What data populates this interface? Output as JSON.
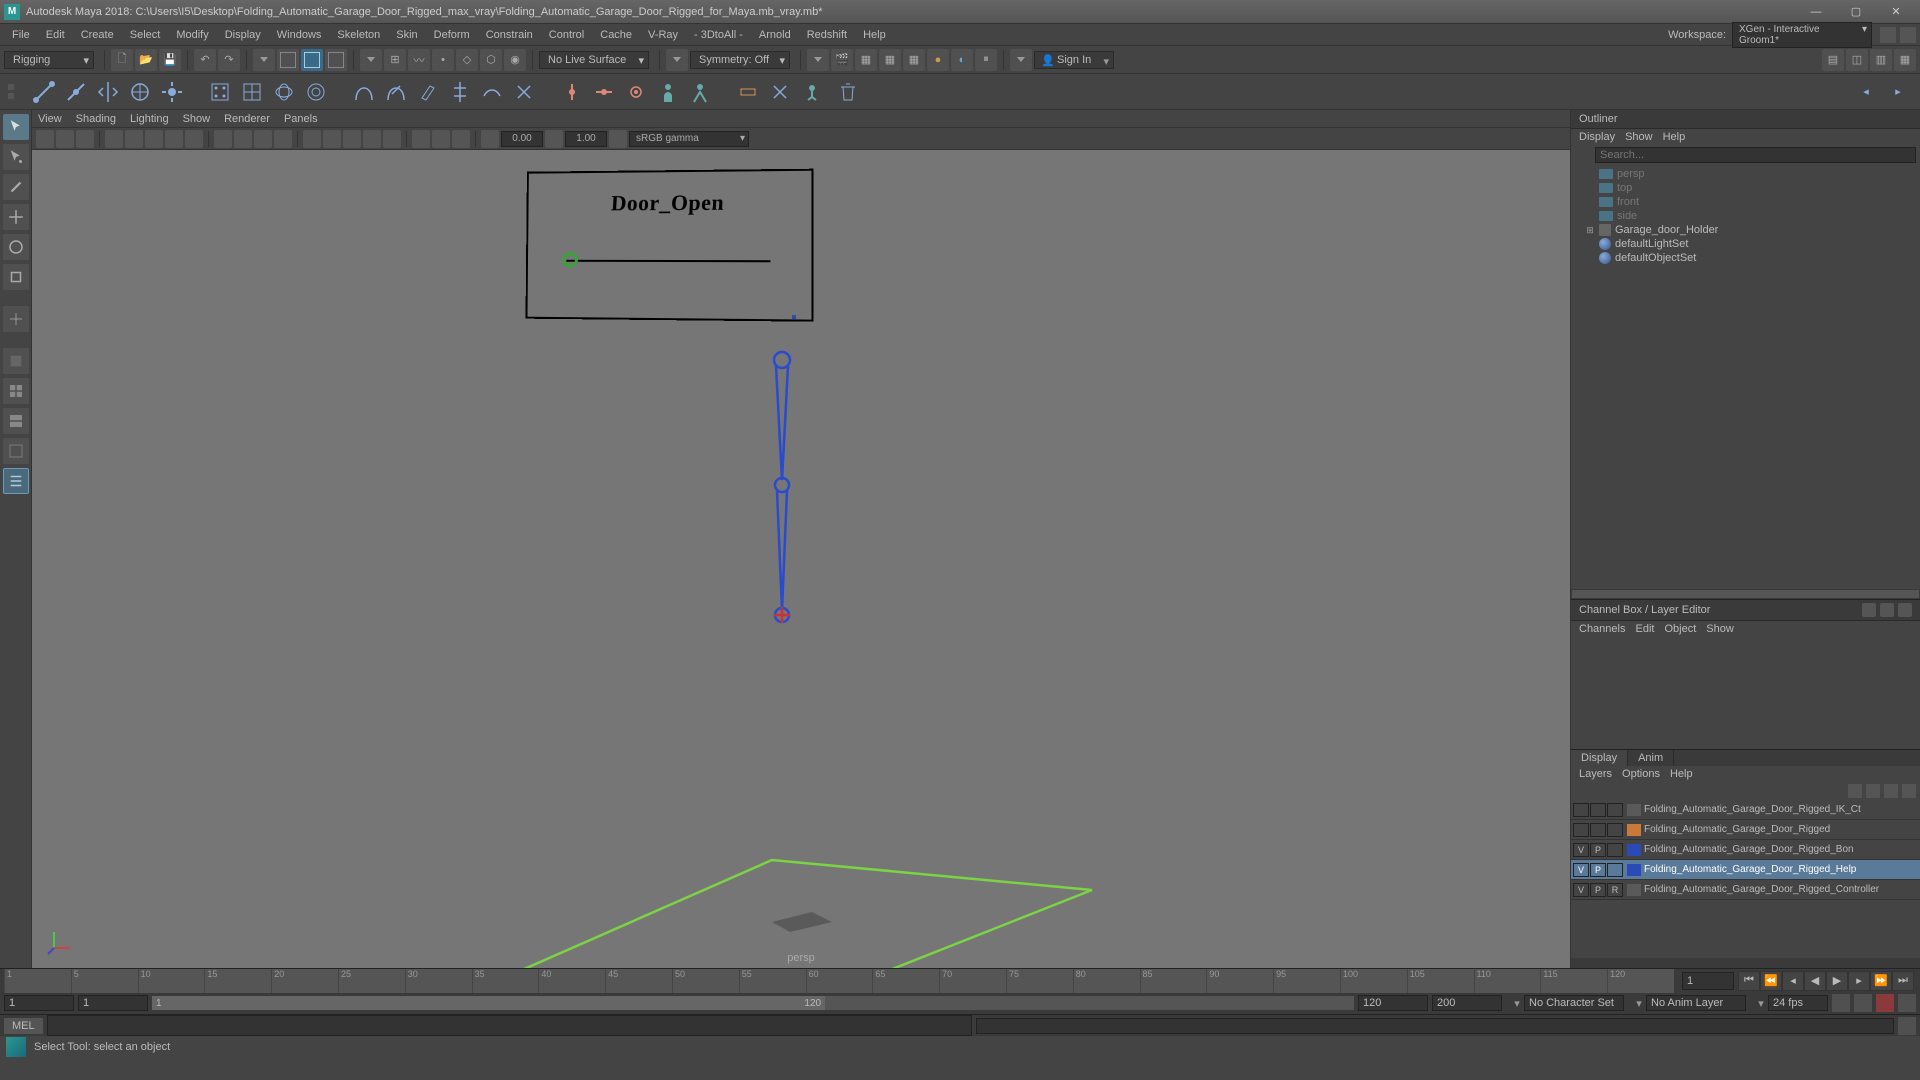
{
  "title": "Autodesk Maya 2018: C:\\Users\\I5\\Desktop\\Folding_Automatic_Garage_Door_Rigged_max_vray\\Folding_Automatic_Garage_Door_Rigged_for_Maya.mb_vray.mb*",
  "menus": [
    "File",
    "Edit",
    "Create",
    "Select",
    "Modify",
    "Display",
    "Windows",
    "Skeleton",
    "Skin",
    "Deform",
    "Constrain",
    "Control",
    "Cache",
    "V-Ray",
    "- 3DtoAll -",
    "Arnold",
    "Redshift",
    "Help"
  ],
  "workspace_label": "Workspace:",
  "workspace_value": "XGen - Interactive Groom1*",
  "toolbar": {
    "menuset": "Rigging",
    "no_live": "No Live Surface",
    "symmetry": "Symmetry: Off",
    "signin": "Sign In"
  },
  "viewport_menu": [
    "View",
    "Shading",
    "Lighting",
    "Show",
    "Renderer",
    "Panels"
  ],
  "viewport_vals": {
    "near": "0.00",
    "far": "1.00",
    "gamma": "sRGB gamma"
  },
  "viewport": {
    "card_label": "Door_Open",
    "camera": "persp"
  },
  "outliner": {
    "title": "Outliner",
    "menu": [
      "Display",
      "Show",
      "Help"
    ],
    "search_placeholder": "Search...",
    "items": [
      {
        "name": "persp",
        "dim": true,
        "type": "cam"
      },
      {
        "name": "top",
        "dim": true,
        "type": "cam"
      },
      {
        "name": "front",
        "dim": true,
        "type": "cam"
      },
      {
        "name": "side",
        "dim": true,
        "type": "cam"
      },
      {
        "name": "Garage_door_Holder",
        "dim": false,
        "type": "grp",
        "exp": true
      },
      {
        "name": "defaultLightSet",
        "dim": false,
        "type": "set"
      },
      {
        "name": "defaultObjectSet",
        "dim": false,
        "type": "set"
      }
    ]
  },
  "cbox": {
    "title": "Channel Box / Layer Editor",
    "menu": [
      "Channels",
      "Edit",
      "Object",
      "Show"
    ]
  },
  "layers": {
    "tabs": [
      "Display",
      "Anim"
    ],
    "menu": [
      "Layers",
      "Options",
      "Help"
    ],
    "rows": [
      {
        "v": "",
        "p": "",
        "r": "",
        "color": "#5a5a5a",
        "name": "Folding_Automatic_Garage_Door_Rigged_IK_Ct",
        "sel": false
      },
      {
        "v": "",
        "p": "",
        "r": "",
        "color": "#c97a3a",
        "name": "Folding_Automatic_Garage_Door_Rigged",
        "sel": false
      },
      {
        "v": "V",
        "p": "P",
        "r": "",
        "color": "#2a4ab8",
        "name": "Folding_Automatic_Garage_Door_Rigged_Bon",
        "sel": false
      },
      {
        "v": "V",
        "p": "P",
        "r": "",
        "color": "#2a4ab8",
        "name": "Folding_Automatic_Garage_Door_Rigged_Help",
        "sel": true
      },
      {
        "v": "V",
        "p": "P",
        "r": "R",
        "color": "#5a5a5a",
        "name": "Folding_Automatic_Garage_Door_Rigged_Controller",
        "sel": false
      }
    ]
  },
  "time": {
    "ticks": [
      "1",
      "5",
      "10",
      "15",
      "20",
      "25",
      "30",
      "35",
      "40",
      "45",
      "50",
      "55",
      "60",
      "65",
      "70",
      "75",
      "80",
      "85",
      "90",
      "95",
      "100",
      "105",
      "110",
      "115",
      "120"
    ],
    "current": "1"
  },
  "range": {
    "start": "1",
    "in": "1",
    "in_label": "1",
    "out_label": "120",
    "out": "120",
    "end": "200",
    "charset": "No Character Set",
    "animlayer": "No Anim Layer",
    "fps": "24 fps"
  },
  "cmd": {
    "lang": "MEL"
  },
  "help": "Select Tool: select an object"
}
